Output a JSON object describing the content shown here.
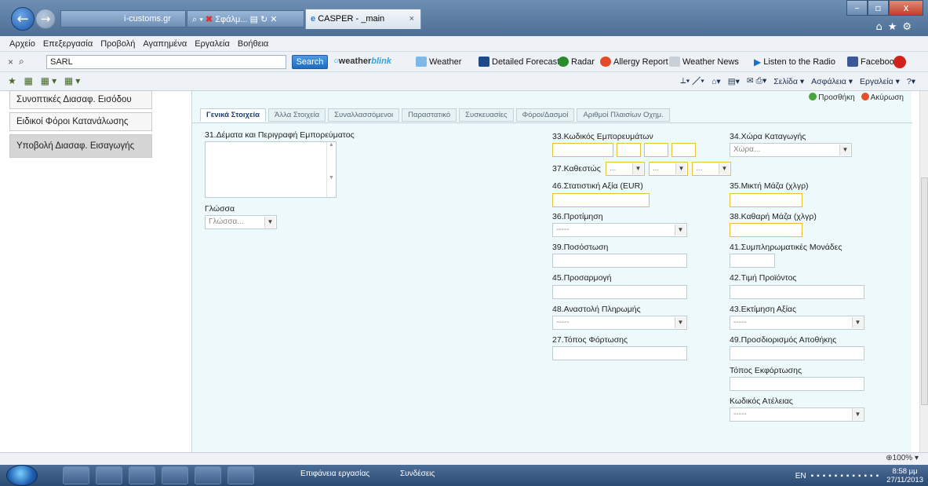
{
  "browser": {
    "addr_domain": "i-customs.gr",
    "addr_tools": "Σφάλμ...",
    "tab_title": "CASPER - _main",
    "window_buttons": [
      "–",
      "▫",
      "x"
    ]
  },
  "menu": [
    "Αρχείο",
    "Επεξεργασία",
    "Προβολή",
    "Αγαπημένα",
    "Εργαλεία",
    "Βοήθεια"
  ],
  "searchbar": {
    "query": "SARL",
    "search_label": "Search",
    "weather_brand": "weather",
    "weather_brand2": "blink",
    "items": [
      "Weather",
      "Detailed Forecast",
      "Radar",
      "Allergy Report",
      "Weather News",
      "Listen to the Radio",
      "Facebook"
    ]
  },
  "commandbar": [
    "Σελίδα ▾",
    "Ασφάλεια ▾",
    "Εργαλεία ▾"
  ],
  "sidebar": [
    {
      "label": "Συνοπτικές Διασαφ. Εισόδου"
    },
    {
      "label": "Ειδικοί Φόροι Κατανάλωσης"
    },
    {
      "label": "Υποβολή Διασαφ. Εισαγωγής"
    }
  ],
  "actions": {
    "add": "Προσθήκη",
    "cancel": "Ακύρωση"
  },
  "tabs": [
    "Γενικά Στοιχεία",
    "Άλλα Στοιχεία",
    "Συναλλασσόμενοι",
    "Παραστατικό",
    "Συσκευασίες",
    "Φόροι/Δασμοί",
    "Αριθμοί Πλαισίων Οχημ."
  ],
  "form": {
    "f31": "31.Δέματα και Περιγραφή Εμπορεύματος",
    "lang_label": "Γλώσσα",
    "lang_placeholder": "Γλώσσα...",
    "f33": "33.Κωδικός Εμπορευμάτων",
    "f37": "37.Καθεστώς",
    "f37_placeholder": "...",
    "f46": "46.Στατιστική Αξία (EUR)",
    "f36": "36.Προτίμηση",
    "f39": "39.Ποσόστωση",
    "f45": "45.Προσαρμογή",
    "f48": "48.Αναστολή Πληρωμής",
    "f27": "27.Τόπος Φόρτωσης",
    "f34": "34.Χώρα Καταγωγής",
    "f34_placeholder": "Χώρα...",
    "f35": "35.Μικτή Μάζα (χλγρ)",
    "f38": "38.Καθαρή Μάζα (χλγρ)",
    "f41": "41.Συμπληρωματικές Μονάδες",
    "f42": "42.Τιμή Προϊόντος",
    "f43": "43.Εκτίμηση Αξίας",
    "f49": "49.Προσδιορισμός Αποθήκης",
    "unload": "Τόπος Εκφόρτωσης",
    "exempt": "Κωδικός Ατέλειας",
    "dash": "-----"
  },
  "status": {
    "zoom": "100%"
  },
  "taskbar": {
    "desktop": "Επιφάνεια εργασίας",
    "connections": "Συνδέσεις",
    "lang": "EN",
    "time": "8:58 μμ",
    "date": "27/11/2013"
  }
}
